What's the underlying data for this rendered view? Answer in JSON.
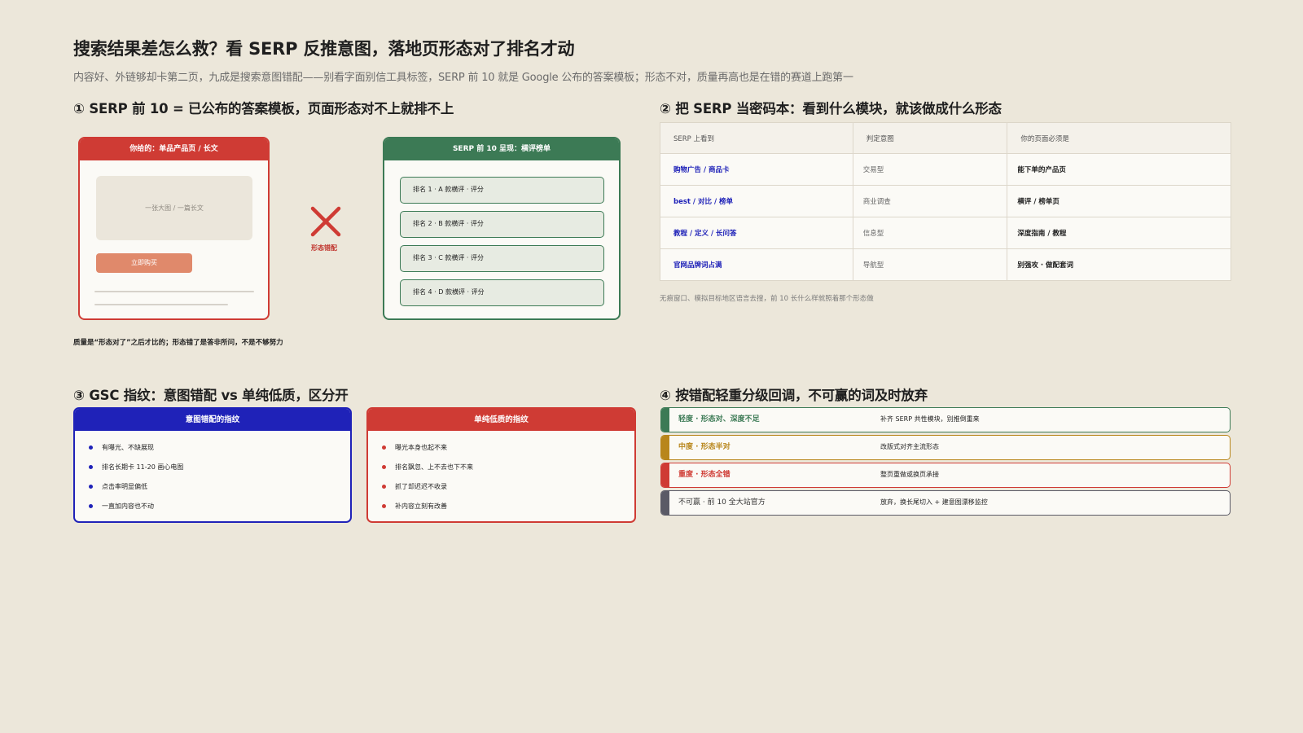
{
  "header": {
    "title": "搜索结果差怎么救？看 SERP 反推意图，落地页形态对了排名才动",
    "subtitle": "内容好、外链够却卡第二页，九成是搜索意图错配——别看字面别信工具标签，SERP 前 10 就是 Google 公布的答案模板；形态不对，质量再高也是在错的赛道上跑第一"
  },
  "section1": {
    "heading": "① SERP 前 10 = 已公布的答案模板，页面形态对不上就排不上",
    "yours": {
      "label": "你给的：单品产品页 / 长文",
      "image_text": "一张大图 / 一篇长文",
      "button": "立即购买"
    },
    "mismatch_label": "形态错配",
    "serp": {
      "label": "SERP 前 10 呈现：横评榜单",
      "items": [
        "排名 1 · A 款横评 · 评分",
        "排名 2 · B 款横评 · 评分",
        "排名 3 · C 款横评 · 评分",
        "排名 4 · D 款横评 · 评分"
      ]
    },
    "note": "质量是“形态对了”之后才比的；形态错了是答非所问，不是不够努力"
  },
  "section2": {
    "heading": "② 把 SERP 当密码本：看到什么模块，就该做成什么形态",
    "columns": [
      "SERP 上看到",
      "判定意图",
      "你的页面必须是"
    ],
    "rows": [
      [
        "购物广告 / 商品卡",
        "交易型",
        "能下单的产品页"
      ],
      [
        "best / 对比 / 榜单",
        "商业调查",
        "横评 / 榜单页"
      ],
      [
        "教程 / 定义 / 长问答",
        "信息型",
        "深度指南 / 教程"
      ],
      [
        "官网品牌词占满",
        "导航型",
        "别强攻 · 做配套词"
      ]
    ],
    "note": "无痕窗口、模拟目标地区语言去搜，前 10 长什么样就照着那个形态做"
  },
  "section3": {
    "heading": "③ GSC 指纹：意图错配 vs 单纯低质，区分开",
    "mismatch": {
      "title": "意图错配的指纹",
      "items": [
        "有曝光、不缺展现",
        "排名长期卡 11-20 画心电图",
        "点击率明显偏低",
        "一直加内容也不动"
      ]
    },
    "lowquality": {
      "title": "单纯低质的指纹",
      "items": [
        "曝光本身也起不来",
        "排名飘忽、上不去也下不来",
        "抓了却迟迟不收录",
        "补内容立刻有改善"
      ]
    }
  },
  "section4": {
    "heading": "④ 按错配轻重分级回调，不可赢的词及时放弃",
    "levels": [
      {
        "name": "轻度 · 形态对、深度不足",
        "action": "补齐 SERP 共性模块，别推倒重来",
        "color": "#3c7a55"
      },
      {
        "name": "中度 · 形态半对",
        "action": "改版式对齐主流形态",
        "color": "#b8861b"
      },
      {
        "name": "重度 · 形态全错",
        "action": "整页重做或换页承接",
        "color": "#cf3b34"
      },
      {
        "name": "不可赢 · 前 10 全大站官方",
        "action": "放弃，换长尾切入 + 建意图漂移监控",
        "color": "#5a5a66"
      }
    ]
  },
  "colors": {
    "red": "#cf3b34",
    "green": "#3c7a55",
    "blue": "#1f22b8",
    "amber": "#b8861b",
    "slate": "#5a5a66",
    "background": "#ece7da"
  }
}
